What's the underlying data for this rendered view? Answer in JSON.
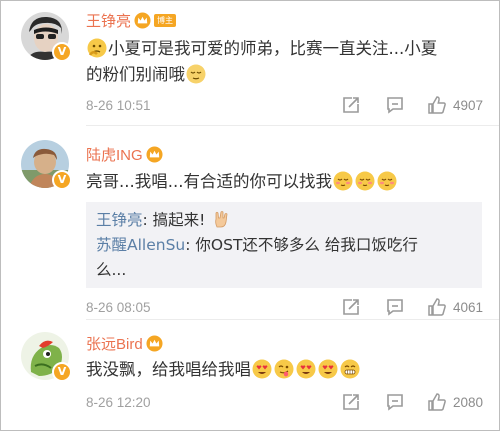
{
  "comments": [
    {
      "user": "王铮亮",
      "tag": "博主",
      "text_a": "小夏可是我可爱的师弟，比赛一直关注...小夏",
      "text_b": "的粉们别闹哦",
      "time": "8-26 10:51",
      "likes": "4907"
    },
    {
      "user": "陆虎ING",
      "text": "亮哥...我唱...有合适的你可以找我",
      "time": "8-26 08:05",
      "likes": "4061",
      "replies": [
        {
          "user": "王铮亮",
          "sep": ":",
          "text": " 搞起来!"
        },
        {
          "user": "苏醒AllenSu",
          "sep": ":",
          "text": " 你OST还不够多么 给我口饭吃行",
          "text2": "么..."
        }
      ]
    },
    {
      "user": "张远Bird",
      "text": "我没飘，给我唱给我唱",
      "time": "8-26 12:20",
      "likes": "2080"
    }
  ],
  "badge_letter": "V",
  "icons": {
    "share": "share-icon",
    "comment": "comment-icon",
    "like": "thumbs-up-icon",
    "crown": "crown-icon",
    "verified": "verified-badge-icon"
  },
  "colors": {
    "username": "#eb7350",
    "reply_username": "#5b7fa6",
    "meta": "#a0a0a0",
    "badge": "#f5a623",
    "reply_bg": "#f2f2f5"
  }
}
